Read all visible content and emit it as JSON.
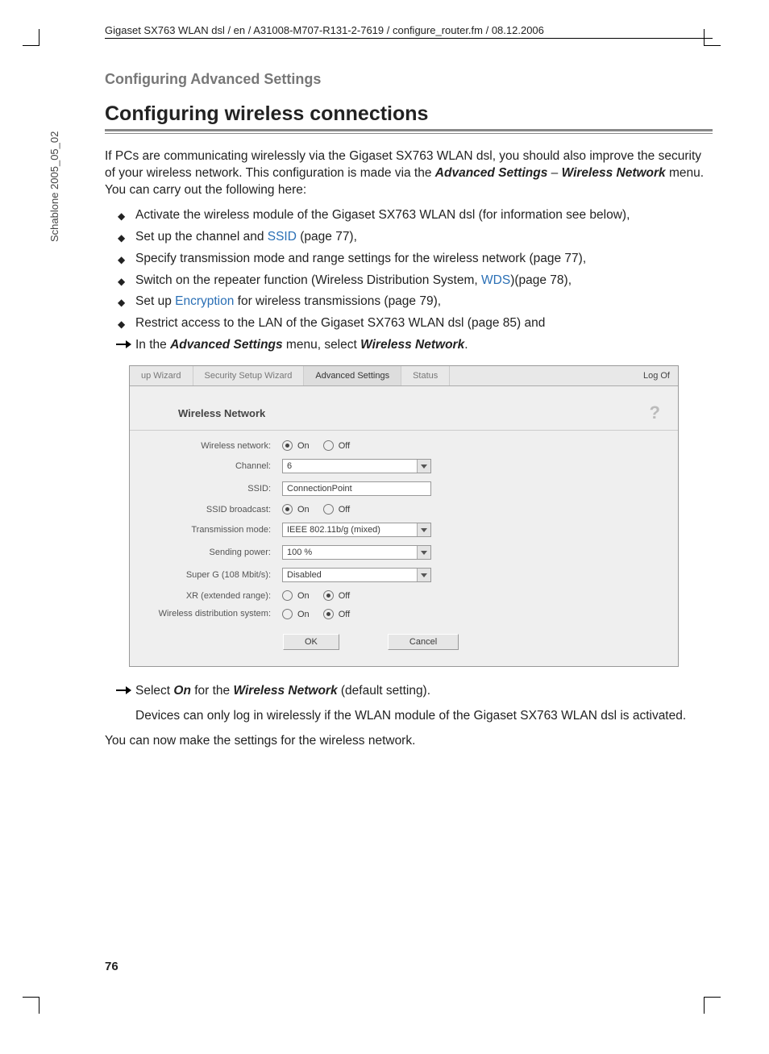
{
  "header": "Gigaset SX763 WLAN dsl / en / A31008-M707-R131-2-7619 / configure_router.fm / 08.12.2006",
  "side_text": "Schablone 2005_05_02",
  "section_label": "Configuring Advanced Settings",
  "title": "Configuring wireless connections",
  "intro": {
    "p1a": "If PCs are communicating wirelessly via the Gigaset SX763 WLAN dsl, you should also improve the security of your wireless network. This configuration is made via the ",
    "p1b_bold": "Advanced Settings",
    "p1c": " – ",
    "p1d_bold": "Wireless Network",
    "p1e": " menu. You can carry out the following here:"
  },
  "bullets": [
    {
      "text": "Activate the wireless module of the Gigaset SX763 WLAN dsl (for information see below),"
    },
    {
      "pre": "Set up the channel and ",
      "link": "SSID",
      "post": " (page 77),"
    },
    {
      "text": "Specify transmission mode and range settings for the wireless network (page 77),"
    },
    {
      "pre": "Switch on the repeater function (Wireless Distribution System, ",
      "link": "WDS",
      "post": ")(page 78),"
    },
    {
      "pre": "Set up ",
      "link": "Encryption",
      "post": " for wireless transmissions (page 79),"
    },
    {
      "text": "Restrict access to the LAN of the Gigaset SX763 WLAN dsl (page 85) and"
    }
  ],
  "arrow1": {
    "pre": "In the ",
    "b1": "Advanced Settings",
    "mid": " menu, select ",
    "b2": "Wireless Network",
    "post": "."
  },
  "router": {
    "tabs": [
      "up Wizard",
      "Security Setup Wizard",
      "Advanced Settings",
      "Status"
    ],
    "active_tab": 2,
    "logoff": "Log Of",
    "heading": "Wireless Network",
    "help": "?",
    "rows": {
      "wireless_network": {
        "label": "Wireless network:",
        "on": "On",
        "off": "Off",
        "value": "on"
      },
      "channel": {
        "label": "Channel:",
        "value": "6"
      },
      "ssid": {
        "label": "SSID:",
        "value": "ConnectionPoint"
      },
      "ssid_broadcast": {
        "label": "SSID broadcast:",
        "on": "On",
        "off": "Off",
        "value": "on"
      },
      "transmission_mode": {
        "label": "Transmission mode:",
        "value": "IEEE 802.11b/g (mixed)"
      },
      "sending_power": {
        "label": "Sending power:",
        "value": "100 %"
      },
      "super_g": {
        "label": "Super G (108 Mbit/s):",
        "value": "Disabled"
      },
      "xr": {
        "label": "XR (extended range):",
        "on": "On",
        "off": "Off",
        "value": "off"
      },
      "wds": {
        "label": "Wireless distribution system:",
        "on": "On",
        "off": "Off",
        "value": "off"
      }
    },
    "buttons": {
      "ok": "OK",
      "cancel": "Cancel"
    }
  },
  "arrow2": {
    "pre": "Select ",
    "b1": "On",
    "mid": " for the ",
    "b2": "Wireless Network",
    "post": " (default setting)."
  },
  "after_arrow2": "Devices can only log in wirelessly if the WLAN module of the Gigaset SX763 WLAN dsl is activated.",
  "closing": "You can now make the settings for the wireless network.",
  "page_number": "76"
}
